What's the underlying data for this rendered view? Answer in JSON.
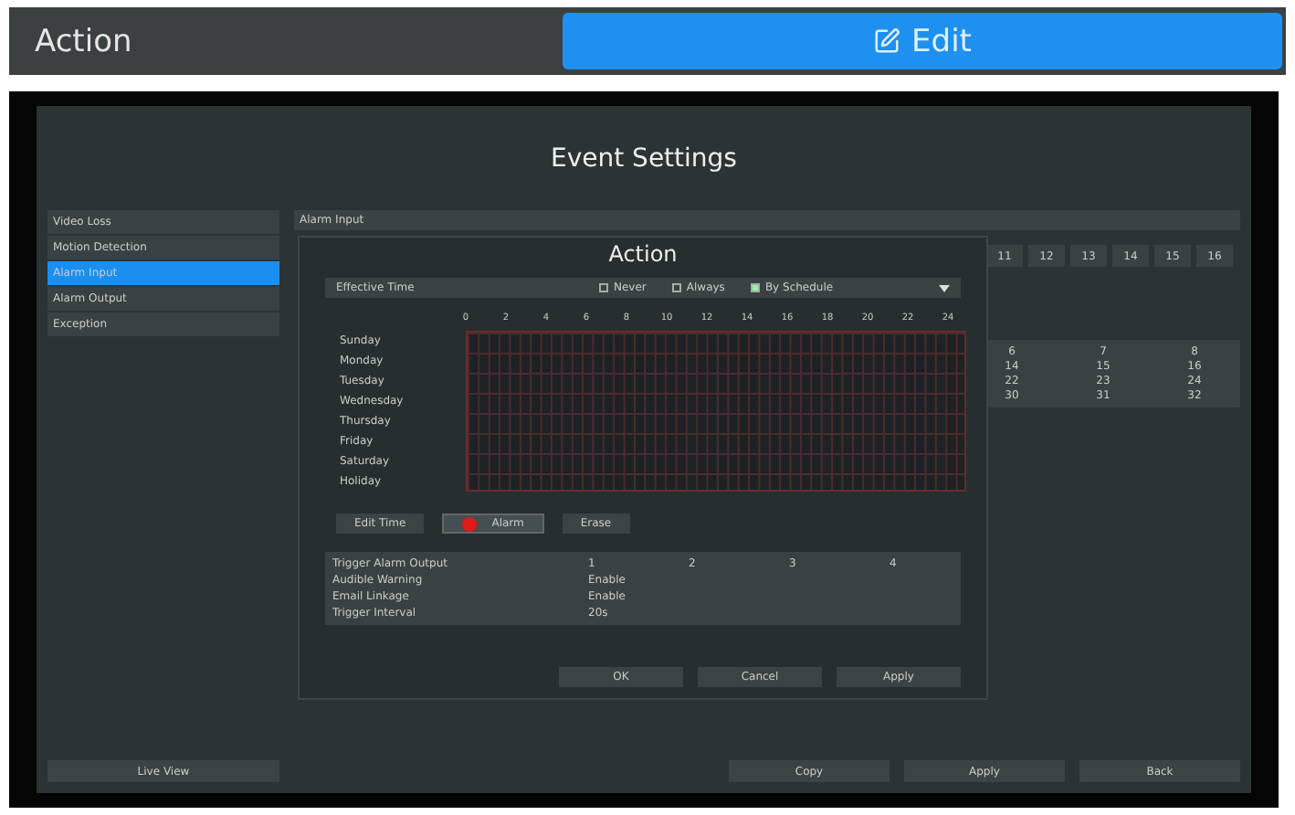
{
  "top_bar": {
    "title": "Action",
    "edit_button": "Edit"
  },
  "window": {
    "title": "Event Settings"
  },
  "sidebar": {
    "items": [
      {
        "label": "Video Loss",
        "selected": false
      },
      {
        "label": "Motion Detection",
        "selected": false
      },
      {
        "label": "Alarm Input",
        "selected": true
      },
      {
        "label": "Alarm Output",
        "selected": false
      },
      {
        "label": "Exception",
        "selected": false
      }
    ],
    "live_view_button": "Live View"
  },
  "main": {
    "header": "Alarm Input",
    "channel_numbers": [
      "11",
      "12",
      "13",
      "14",
      "15",
      "16"
    ],
    "table_rows": [
      [
        "6",
        "7",
        "8"
      ],
      [
        "14",
        "15",
        "16"
      ],
      [
        "22",
        "23",
        "24"
      ],
      [
        "30",
        "31",
        "32"
      ]
    ]
  },
  "dialog": {
    "title": "Action",
    "effective_time": {
      "label": "Effective Time",
      "options": [
        {
          "label": "Never",
          "selected": false
        },
        {
          "label": "Always",
          "selected": false
        },
        {
          "label": "By Schedule",
          "selected": true
        }
      ]
    },
    "hours": [
      "0",
      "2",
      "4",
      "6",
      "8",
      "10",
      "12",
      "14",
      "16",
      "18",
      "20",
      "22",
      "24"
    ],
    "days": [
      "Sunday",
      "Monday",
      "Tuesday",
      "Wednesday",
      "Thursday",
      "Friday",
      "Saturday",
      "Holiday"
    ],
    "tools": [
      {
        "kind": "button",
        "label": "Edit Time",
        "selected": false
      },
      {
        "kind": "brush",
        "label": "Alarm",
        "selected": true
      },
      {
        "kind": "button",
        "label": "Erase",
        "selected": false
      }
    ],
    "settings": [
      {
        "label": "Trigger Alarm Output",
        "values": [
          "1",
          "2",
          "3",
          "4"
        ]
      },
      {
        "label": "Audible Warning",
        "values": [
          "Enable"
        ]
      },
      {
        "label": "Email Linkage",
        "values": [
          "Enable"
        ]
      },
      {
        "label": "Trigger Interval",
        "values": [
          "20s"
        ]
      }
    ],
    "buttons": [
      "OK",
      "Cancel",
      "Apply"
    ]
  },
  "footer_buttons": [
    "Copy",
    "Apply",
    "Back"
  ]
}
